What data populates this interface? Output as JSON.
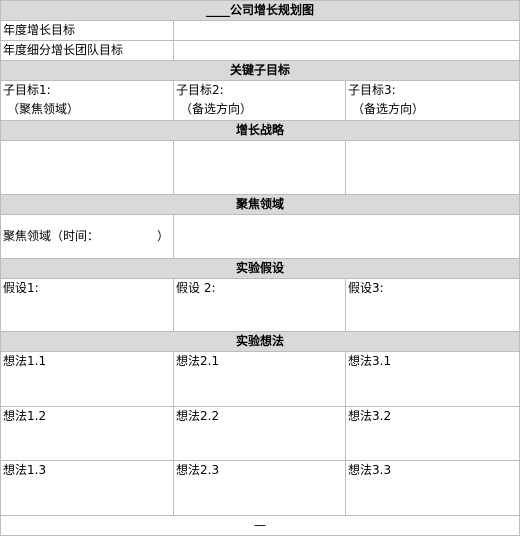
{
  "title": {
    "blank": "____",
    "text": "公司增长规划图"
  },
  "annual": {
    "growth_target_label": "年度增长目标",
    "team_target_label": "年度细分增长团队目标"
  },
  "key_subgoals": {
    "header": "关键子目标",
    "items": [
      {
        "label": "子目标1:",
        "note": "（聚焦领域）"
      },
      {
        "label": "子目标2:",
        "note": "（备选方向）"
      },
      {
        "label": "子目标3:",
        "note": "（备选方向）"
      }
    ]
  },
  "strategy": {
    "header": "增长战略"
  },
  "focus": {
    "header": "聚焦领域",
    "label_prefix": "聚焦领域（时间：",
    "label_suffix": "）"
  },
  "hypotheses": {
    "header": "实验假设",
    "items": [
      "假设1:",
      "假设 2:",
      "假设3:"
    ]
  },
  "ideas": {
    "header": "实验想法",
    "rows": [
      [
        "想法1.1",
        "想法2.1",
        "想法3.1"
      ],
      [
        "想法1.2",
        "想法2.2",
        "想法3.2"
      ],
      [
        "想法1.3",
        "想法2.3",
        "想法3.3"
      ]
    ]
  },
  "footer": {
    "text": "—"
  }
}
